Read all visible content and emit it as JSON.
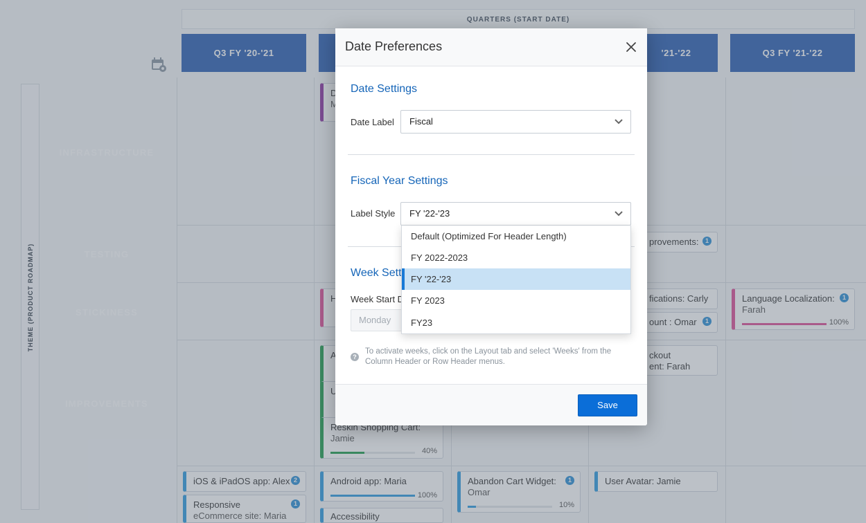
{
  "roadmap": {
    "quarters_label": "QUARTERS (START DATE)",
    "column_headers": [
      "Q3 FY '20-'21",
      "'21-'22",
      "Q3 FY '21-'22"
    ],
    "side_label": "THEME (PRODUCT ROADMAP)",
    "themes": [
      {
        "name": "INFRASTRUCTURE",
        "color": "#8e35a3"
      },
      {
        "name": "TESTING",
        "color": "#d92632"
      },
      {
        "name": "STICKINESS",
        "color": "#df4f97"
      },
      {
        "name": "IMPROVEMENTS",
        "color": "#1f9e4c"
      },
      {
        "name": "",
        "color": "#1f8fd8"
      }
    ],
    "cards": {
      "c1_a": "D",
      "c1_b": "M",
      "c2": "provements:",
      "c2_badge": "1",
      "c3": "H",
      "c4": "fications: Carly",
      "c5": "ount : Omar",
      "c5_badge": "1",
      "c6_title": "Language Localization:",
      "c6_sub": "Farah",
      "c6_badge": "1",
      "c6_pct": "100%",
      "c6_progress": 1.0,
      "c7": "A",
      "c8_a": "ckout",
      "c8_b": "ent: Farah",
      "c9": "U",
      "c10_title": "Reskin Shopping Cart:",
      "c10_sub": "Jamie",
      "c10_pct": "40%",
      "c10_progress": 0.4,
      "c11": "iOS & iPadOS app: Alex",
      "c11_badge": "2",
      "c12": "Android app: Maria",
      "c12_pct": "100%",
      "c12_progress": 1.0,
      "c13_title": "Abandon Cart Widget:",
      "c13_sub": "Omar",
      "c13_badge": "1",
      "c13_pct": "10%",
      "c13_progress": 0.1,
      "c14": "User Avatar: Jamie",
      "c15_title": "Responsive",
      "c15_sub": "eCommerce site: Maria",
      "c15_badge": "1",
      "c16": "Accessibility"
    }
  },
  "modal": {
    "title": "Date Preferences",
    "date_settings": {
      "title": "Date Settings",
      "label": "Date Label",
      "value": "Fiscal"
    },
    "fiscal_settings": {
      "title": "Fiscal Year Settings",
      "label": "Label Style",
      "value": "FY '22-'23",
      "options": [
        "Default (Optimized For Header Length)",
        "FY 2022-2023",
        "FY '22-'23",
        "FY 2023",
        "FY23"
      ],
      "selected_index": 2
    },
    "week_settings": {
      "title": "Week Setti",
      "label": "Week Start D",
      "value": "Monday"
    },
    "help_text": "To activate weeks, click on the Layout tab and select 'Weeks' from the Column Header or Row Header menus.",
    "save_label": "Save"
  },
  "colors": {
    "accent": "#0b6ed8",
    "header_blue": "#2b5fb4",
    "section_title": "#1565b8",
    "selected_option": "#c8e1f5"
  }
}
